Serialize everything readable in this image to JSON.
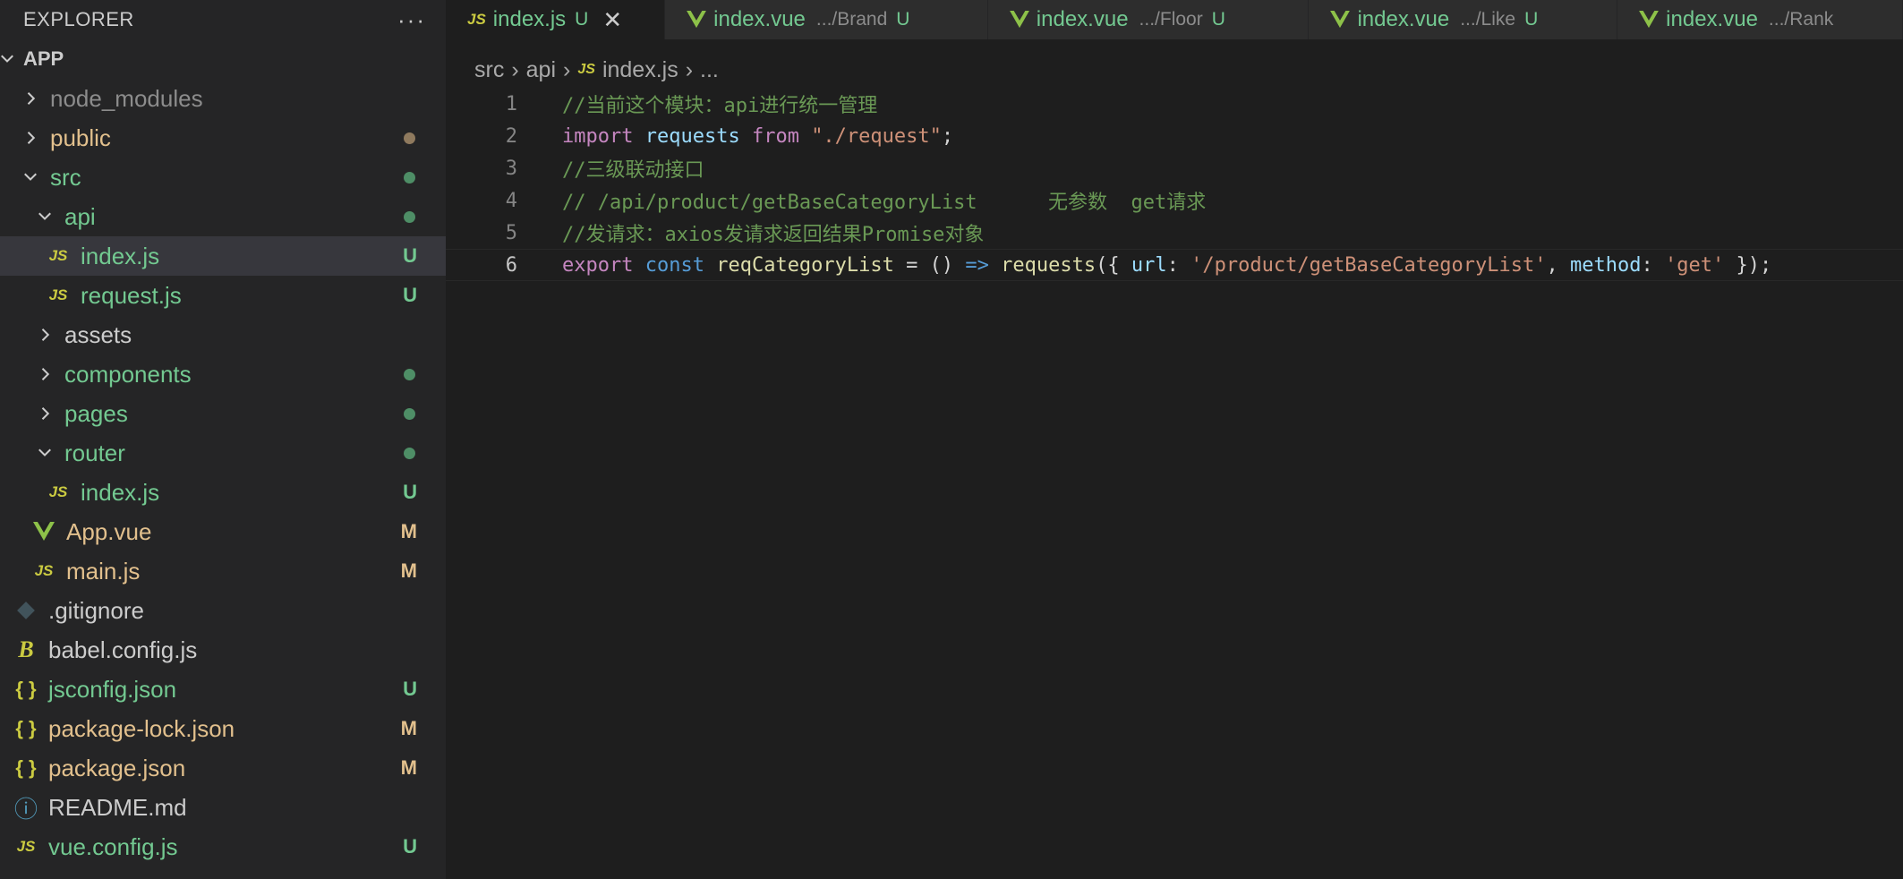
{
  "explorer": {
    "title": "EXPLORER",
    "more": "···",
    "root": "APP",
    "items": [
      {
        "label": "node_modules",
        "badge": "",
        "kind": "folder",
        "collapsed": true
      },
      {
        "label": "public",
        "badge": "●"
      },
      {
        "label": "src",
        "badge": "●"
      },
      {
        "label": "api",
        "badge": "●"
      },
      {
        "label": "index.js",
        "badge": "U"
      },
      {
        "label": "request.js",
        "badge": "U"
      },
      {
        "label": "assets",
        "badge": ""
      },
      {
        "label": "components",
        "badge": "●"
      },
      {
        "label": "pages",
        "badge": "●"
      },
      {
        "label": "router",
        "badge": "●"
      },
      {
        "label": "index.js",
        "badge": "U"
      },
      {
        "label": "App.vue",
        "badge": "M"
      },
      {
        "label": "main.js",
        "badge": "M"
      },
      {
        "label": ".gitignore",
        "badge": ""
      },
      {
        "label": "babel.config.js",
        "badge": ""
      },
      {
        "label": "jsconfig.json",
        "badge": "U"
      },
      {
        "label": "package-lock.json",
        "badge": "M"
      },
      {
        "label": "package.json",
        "badge": "M"
      },
      {
        "label": "README.md",
        "badge": ""
      },
      {
        "label": "vue.config.js",
        "badge": "U"
      }
    ],
    "icons": {
      "js": "JS",
      "json": "{ }",
      "info": "ⓘ",
      "babel": "B"
    }
  },
  "tabs": [
    {
      "name": "index.js",
      "path": "",
      "status": "U",
      "close": "✕"
    },
    {
      "name": "index.vue",
      "path": ".../Brand",
      "status": "U"
    },
    {
      "name": "index.vue",
      "path": ".../Floor",
      "status": "U"
    },
    {
      "name": "index.vue",
      "path": ".../Like",
      "status": "U"
    },
    {
      "name": "index.vue",
      "path": ".../Rank",
      "status": ""
    }
  ],
  "breadcrumb": {
    "p1": "src",
    "p2": "api",
    "p3": "index.js",
    "p4": "...",
    "sep": "›"
  },
  "code": {
    "lines": [
      "1",
      "2",
      "3",
      "4",
      "5",
      "6"
    ],
    "l1": "//当前这个模块：api进行统一管理",
    "l2": {
      "kw": "import",
      "var": "requests",
      "from": "from",
      "str": "\"./request\"",
      "end": ";"
    },
    "l3": "//三级联动接口",
    "l4": "// /api/product/getBaseCategoryList      无参数  get请求",
    "l5": "//发请求：axios发请求返回结果Promise对象",
    "l6": {
      "kw": "export",
      "const": "const",
      "fn": "reqCategoryList",
      "eq": " = ",
      "paren": "() ",
      "arrow": "=>",
      "call": " requests",
      "open": "({ ",
      "url": "url",
      "colon1": ": ",
      "urlval": "'/product/getBaseCategoryList'",
      "comma": ", ",
      "method": "method",
      "colon2": ": ",
      "methodval": "'get'",
      "close": " });"
    }
  }
}
